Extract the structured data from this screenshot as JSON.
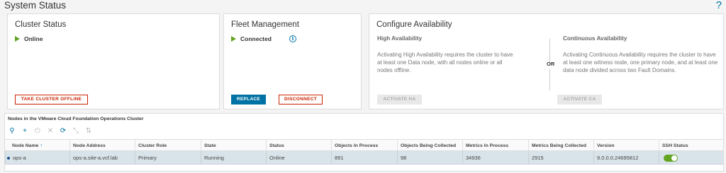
{
  "page": {
    "title": "System Status",
    "help": "?"
  },
  "cluster_status": {
    "title": "Cluster Status",
    "status": "Online",
    "take_offline_label": "TAKE CLUSTER OFFLINE"
  },
  "fleet": {
    "title": "Fleet Management",
    "status": "Connected",
    "info_glyph": "i",
    "replace_label": "REPLACE",
    "disconnect_label": "DISCONNECT"
  },
  "availability": {
    "title": "Configure Availability",
    "ha_title": "High Availability",
    "ha_desc": "Activating High Availability requires the cluster to have at least one Data node, with all nodes online or all nodes offline.",
    "ha_button": "ACTIVATE HA",
    "or_label": "OR",
    "ca_title": "Continuous Availability",
    "ca_desc": "Activating Continuous Availability requires the cluster to have at least one witness node, one primary node, and at least one data node divided across two Fault Domains.",
    "ca_button": "ACTIVATE CA"
  },
  "nodes_table": {
    "title": "Nodes in the VMware Cloud Foundation Operations Cluster",
    "toolbar": [
      {
        "name": "zoom-icon",
        "glyph": "⚲",
        "enabled": true
      },
      {
        "name": "add-icon",
        "glyph": "+",
        "enabled": true
      },
      {
        "name": "power-icon",
        "glyph": "⏻",
        "enabled": false
      },
      {
        "name": "remove-icon",
        "glyph": "✕",
        "enabled": false
      },
      {
        "name": "refresh-icon",
        "glyph": "⟳",
        "enabled": true
      },
      {
        "name": "collapse-icon",
        "glyph": "⤡",
        "enabled": false
      },
      {
        "name": "swap-icon",
        "glyph": "⇅",
        "enabled": false
      }
    ],
    "columns": [
      "Node Name",
      "Node Address",
      "Cluster Role",
      "State",
      "Status",
      "Objects In Process",
      "Objects Being Collected",
      "Metrics In Process",
      "Metrics Being Collected",
      "Version",
      "SSH Status"
    ],
    "sort_indicator": "↑",
    "rows": [
      {
        "node_name": "ops-a",
        "node_address": "ops-a.site-a.vcf.lab",
        "cluster_role": "Primary",
        "state": "Running",
        "status": "Online",
        "objects_in_process": "891",
        "objects_being_collected": "98",
        "metrics_in_process": "34936",
        "metrics_being_collected": "2915",
        "version": "9.0.0.0.24695812",
        "ssh_enabled": true
      }
    ]
  }
}
